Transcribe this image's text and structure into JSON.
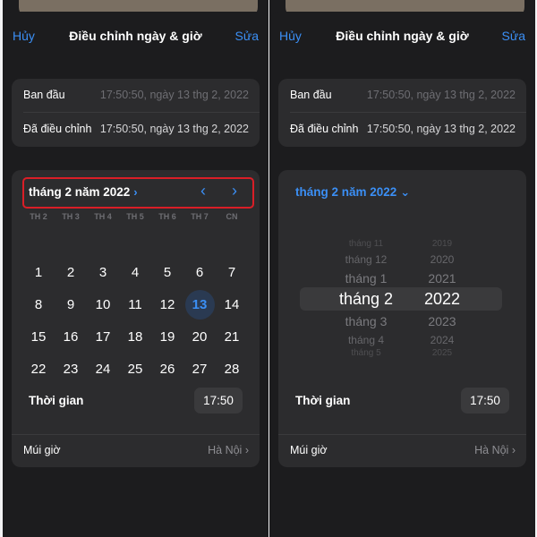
{
  "nav": {
    "cancel": "Hủy",
    "title": "Điều chỉnh ngày & giờ",
    "edit": "Sửa"
  },
  "info": {
    "original_label": "Ban đầu",
    "original_value": "17:50:50, ngày 13 thg 2, 2022",
    "adjusted_label": "Đã điều chỉnh",
    "adjusted_value": "17:50:50, ngày 13 thg 2, 2022"
  },
  "calendar": {
    "month_title": "tháng 2 năm 2022",
    "chevron_right": "›",
    "chevron_down": "⌄",
    "prev_arrow": "‹",
    "next_arrow": "›",
    "weekdays": [
      "TH 2",
      "TH 3",
      "TH 4",
      "TH 5",
      "TH 6",
      "TH 7",
      "CN"
    ],
    "days": [
      "1",
      "2",
      "3",
      "4",
      "5",
      "6",
      "7",
      "8",
      "9",
      "10",
      "11",
      "12",
      "13",
      "14",
      "15",
      "16",
      "17",
      "18",
      "19",
      "20",
      "21",
      "22",
      "23",
      "24",
      "25",
      "26",
      "27",
      "28"
    ],
    "selected_day": "13",
    "first_weekday_index": 1
  },
  "picker": {
    "months": [
      "tháng 11",
      "tháng 12",
      "tháng 1",
      "tháng 2",
      "tháng 3",
      "tháng 4",
      "tháng 5"
    ],
    "years": [
      "2019",
      "2020",
      "2021",
      "2022",
      "2023",
      "2024",
      "2025"
    ],
    "selected_index": 3
  },
  "time": {
    "label": "Thời gian",
    "value": "17:50"
  },
  "timezone": {
    "label": "Múi giờ",
    "value": "Hà Nội",
    "chevron": "›"
  },
  "colors": {
    "accent": "#3b8ff5",
    "highlight_box": "#d91e27"
  }
}
